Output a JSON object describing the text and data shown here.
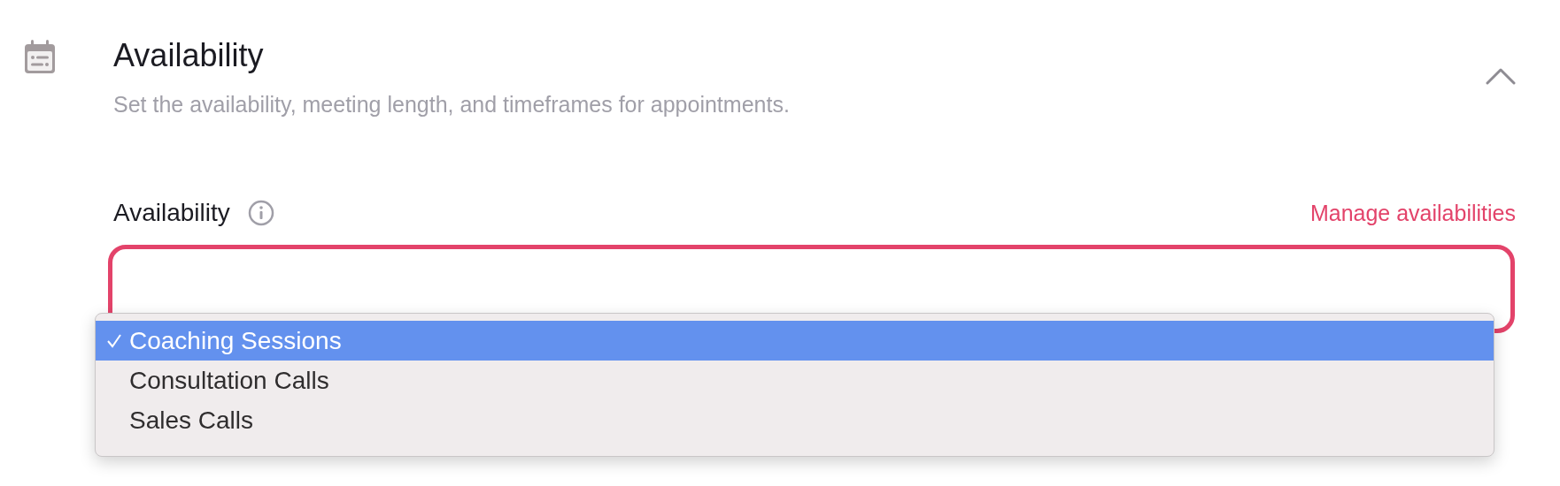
{
  "section": {
    "title": "Availability",
    "description": "Set the availability, meeting length, and timeframes for appointments.",
    "expanded": true
  },
  "field": {
    "label": "Availability",
    "link": "Manage availabilities"
  },
  "dropdown": {
    "options": [
      {
        "label": "Coaching Sessions",
        "selected": true
      },
      {
        "label": "Consultation Calls",
        "selected": false
      },
      {
        "label": "Sales Calls",
        "selected": false
      }
    ]
  }
}
